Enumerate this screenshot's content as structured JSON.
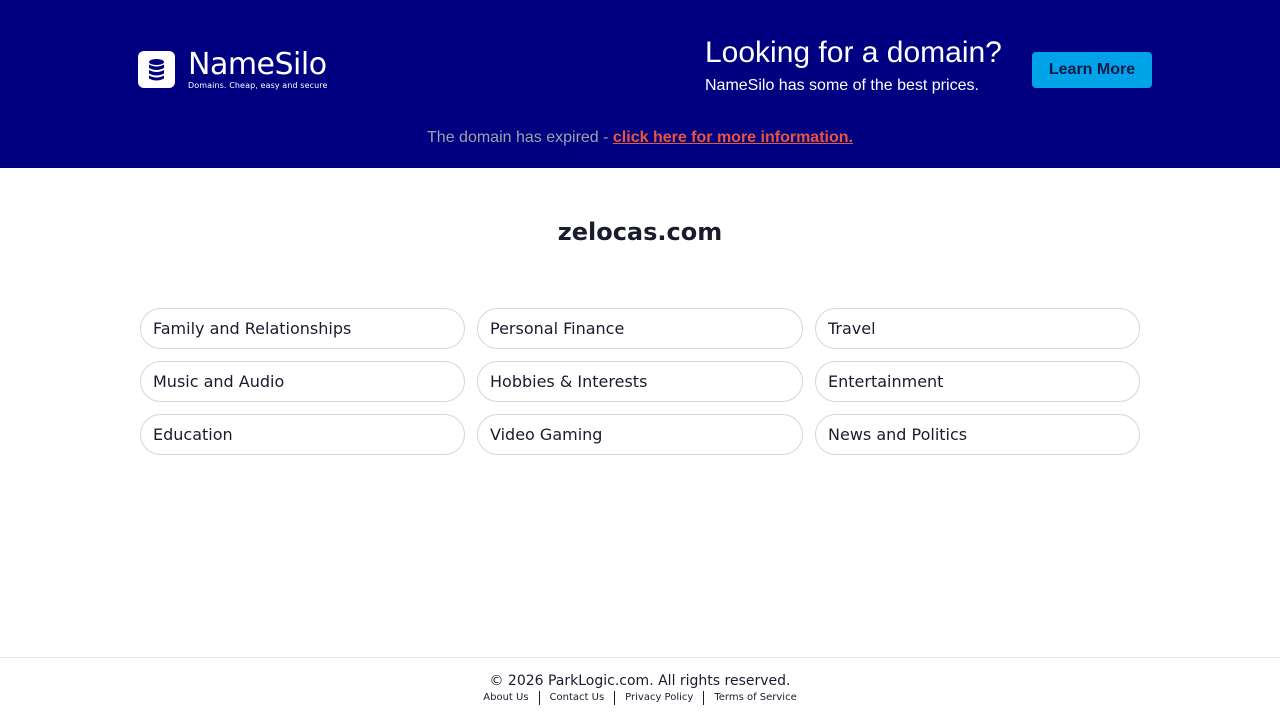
{
  "header": {
    "logo": {
      "name": "NameSilo",
      "tagline": "Domains. Cheap, easy and secure",
      "icon": "database-icon"
    },
    "promo_title": "Looking for a domain?",
    "promo_subtitle": "NameSilo has some of the best prices.",
    "learn_more_label": "Learn More",
    "expired_text": "The domain has expired - ",
    "expired_link": "click here for more information.",
    "colors": {
      "background": "#000080",
      "button": "#00a2e8",
      "link": "#e8553f"
    }
  },
  "main": {
    "domain": "zelocas.com",
    "categories": [
      "Family and Relationships",
      "Personal Finance",
      "Travel",
      "Music and Audio",
      "Hobbies & Interests",
      "Entertainment",
      "Education",
      "Video Gaming",
      "News and Politics"
    ]
  },
  "footer": {
    "copyright": "© 2026 ParkLogic.com. All rights reserved.",
    "links": [
      "About Us",
      "Contact Us",
      "Privacy Policy",
      "Terms of Service"
    ]
  }
}
